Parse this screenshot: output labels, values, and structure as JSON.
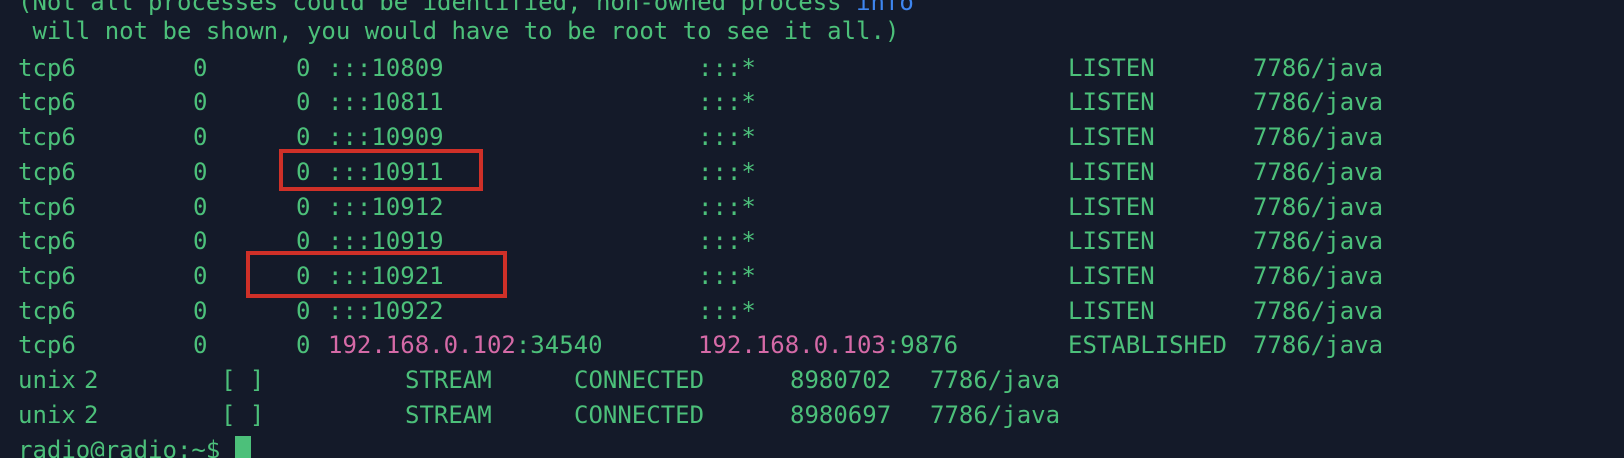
{
  "terminal": {
    "header_line_1": {
      "pre": "(Not all processes could be identified, non-owned process ",
      "keyword": "info"
    },
    "header_line_2": " will not be shown, you would have to be root to see it all.)",
    "tcp_rows": [
      {
        "proto": "tcp6",
        "recvq": "0",
        "sendq": "0",
        "local": ":::10809",
        "foreign": ":::*",
        "state": "LISTEN",
        "program": "7786/java"
      },
      {
        "proto": "tcp6",
        "recvq": "0",
        "sendq": "0",
        "local": ":::10811",
        "foreign": ":::*",
        "state": "LISTEN",
        "program": "7786/java"
      },
      {
        "proto": "tcp6",
        "recvq": "0",
        "sendq": "0",
        "local": ":::10909",
        "foreign": ":::*",
        "state": "LISTEN",
        "program": "7786/java"
      },
      {
        "proto": "tcp6",
        "recvq": "0",
        "sendq": "0",
        "local": ":::10911",
        "foreign": ":::*",
        "state": "LISTEN",
        "program": "7786/java"
      },
      {
        "proto": "tcp6",
        "recvq": "0",
        "sendq": "0",
        "local": ":::10912",
        "foreign": ":::*",
        "state": "LISTEN",
        "program": "7786/java"
      },
      {
        "proto": "tcp6",
        "recvq": "0",
        "sendq": "0",
        "local": ":::10919",
        "foreign": ":::*",
        "state": "LISTEN",
        "program": "7786/java"
      },
      {
        "proto": "tcp6",
        "recvq": "0",
        "sendq": "0",
        "local": ":::10921",
        "foreign": ":::*",
        "state": "LISTEN",
        "program": "7786/java"
      },
      {
        "proto": "tcp6",
        "recvq": "0",
        "sendq": "0",
        "local": ":::10922",
        "foreign": ":::*",
        "state": "LISTEN",
        "program": "7786/java"
      }
    ],
    "established_row": {
      "proto": "tcp6",
      "recvq": "0",
      "sendq": "0",
      "local_ip": "192.168.0.102",
      "local_port": ":34540",
      "foreign_ip": "192.168.0.103",
      "foreign_port": ":9876",
      "state": "ESTABLISHED",
      "program": "7786/java"
    },
    "unix_rows": [
      {
        "proto": "unix",
        "refcnt": "2",
        "flags": "[ ]",
        "type": "STREAM",
        "state": "CONNECTED",
        "inode": "8980702",
        "program": "7786/java"
      },
      {
        "proto": "unix",
        "refcnt": "2",
        "flags": "[ ]",
        "type": "STREAM",
        "state": "CONNECTED",
        "inode": "8980697",
        "program": "7786/java"
      }
    ],
    "prompt": "radio@radio:~$ "
  },
  "highlight_color": "#cf3028",
  "text_color": "#4cc07a",
  "ip_color": "#d56aa7",
  "background_color": "#141a29"
}
